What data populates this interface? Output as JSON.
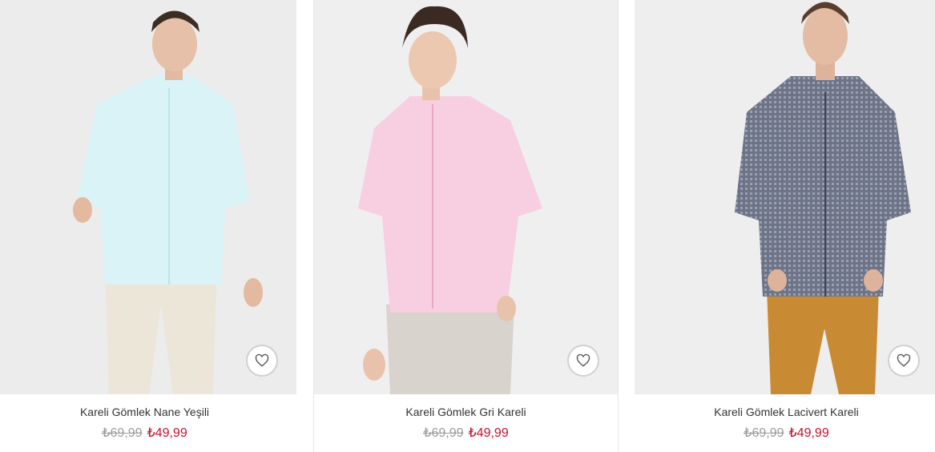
{
  "products": [
    {
      "name": "Kareli Gömlek Nane Yeşili",
      "old_price": "₺69,99",
      "new_price": "₺49,99",
      "shirt_color": "#d9f3f6",
      "pants_color": "#ece6d9"
    },
    {
      "name": "Kareli Gömlek Gri Kareli",
      "old_price": "₺69,99",
      "new_price": "₺49,99",
      "shirt_color": "#f7cfe0",
      "pants_color": "#d8d3cd"
    },
    {
      "name": "Kareli Gömlek Lacivert Kareli",
      "old_price": "₺69,99",
      "new_price": "₺49,99",
      "shirt_color": "#6d7487",
      "pants_color": "#c98a34"
    }
  ],
  "icons": {
    "favorite": "heart-outline-icon"
  },
  "colors": {
    "sale_price": "#c8102e",
    "old_price": "#9b9b9b",
    "title": "#333333"
  }
}
